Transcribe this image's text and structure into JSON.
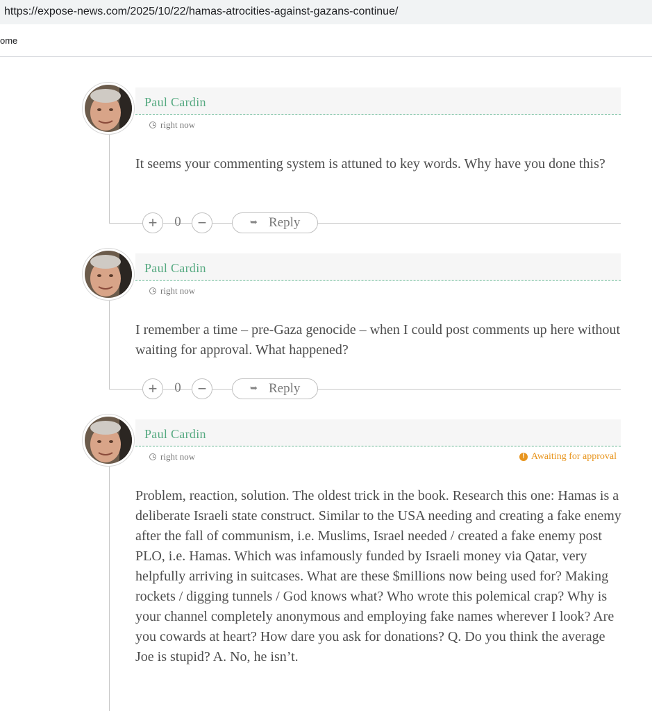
{
  "browser": {
    "url": "https://expose-news.com/2025/10/22/hamas-atrocities-against-gazans-continue/"
  },
  "bookmarks_bar": {
    "item": "ome"
  },
  "comments": [
    {
      "author": "Paul Cardin",
      "time": "right now",
      "text": "It seems your commenting system is attuned to key words. Why have you done this?",
      "votes": "0",
      "reply_label": "Reply"
    },
    {
      "author": "Paul Cardin",
      "time": "right now",
      "text": "I remember a time – pre-Gaza genocide – when I could post comments up here without waiting for approval. What happened?",
      "votes": "0",
      "reply_label": "Reply"
    },
    {
      "author": "Paul Cardin",
      "time": "right now",
      "status": "Awaiting for approval",
      "text": "Problem, reaction, solution. The oldest trick in the book. Research this one: Hamas is a deliberate Israeli state construct. Similar to the USA needing and creating a fake enemy after the fall of communism, i.e. Muslims, Israel needed / created a fake enemy post PLO, i.e. Hamas. Which was infamously funded by Israeli money via Qatar, very helpfully arriving in suitcases. What are these $millions now being used for? Making rockets / digging tunnels / God knows what? Who wrote this polemical crap? Why is your channel completely anonymous and employing fake names wherever I look? Are you cowards at heart? How dare you ask for donations? Q. Do you think the average Joe is stupid? A. No, he isn’t."
    }
  ],
  "icons": {
    "clock": "clock-icon",
    "warning": "warning-icon",
    "reply": "reply-arrow-icon",
    "upvote": "plus-icon",
    "downvote": "minus-icon"
  }
}
